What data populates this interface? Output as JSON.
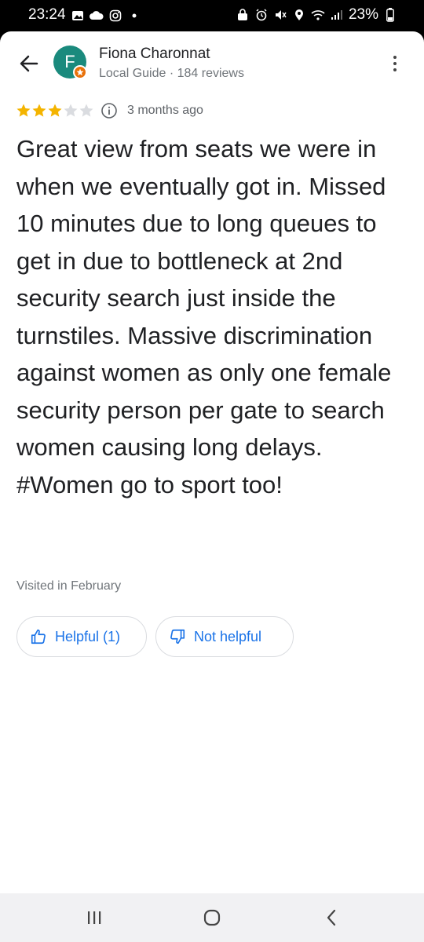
{
  "status_bar": {
    "time": "23:24",
    "battery": "23%",
    "left_icons": [
      "image-icon",
      "cloud-icon",
      "instagram-icon",
      "dot-icon"
    ],
    "right_icons": [
      "lock-icon",
      "alarm-icon",
      "mute-icon",
      "location-icon",
      "wifi-icon",
      "signal-icon",
      "battery-icon"
    ]
  },
  "reviewer": {
    "initial": "F",
    "name": "Fiona Charonnat",
    "meta": "Local Guide · 184 reviews",
    "avatar_color": "#1a8a7d",
    "badge_color": "#e8710a"
  },
  "review": {
    "rating": 3,
    "max_rating": 5,
    "date": "3 months ago",
    "text": "Great view from seats we were in when we eventually got in. Missed 10 minutes due to long queues to get in due to bottleneck at 2nd security search just inside the turnstiles. Massive discrimination against women as only one female security person per gate to search women causing long delays. #Women go to sport too!",
    "visited": "Visited in February"
  },
  "actions": {
    "helpful_label": "Helpful (1)",
    "not_helpful_label": "Not helpful"
  },
  "colors": {
    "star_filled": "#f4b400",
    "star_empty": "#dadce0",
    "accent": "#1a73e8"
  }
}
